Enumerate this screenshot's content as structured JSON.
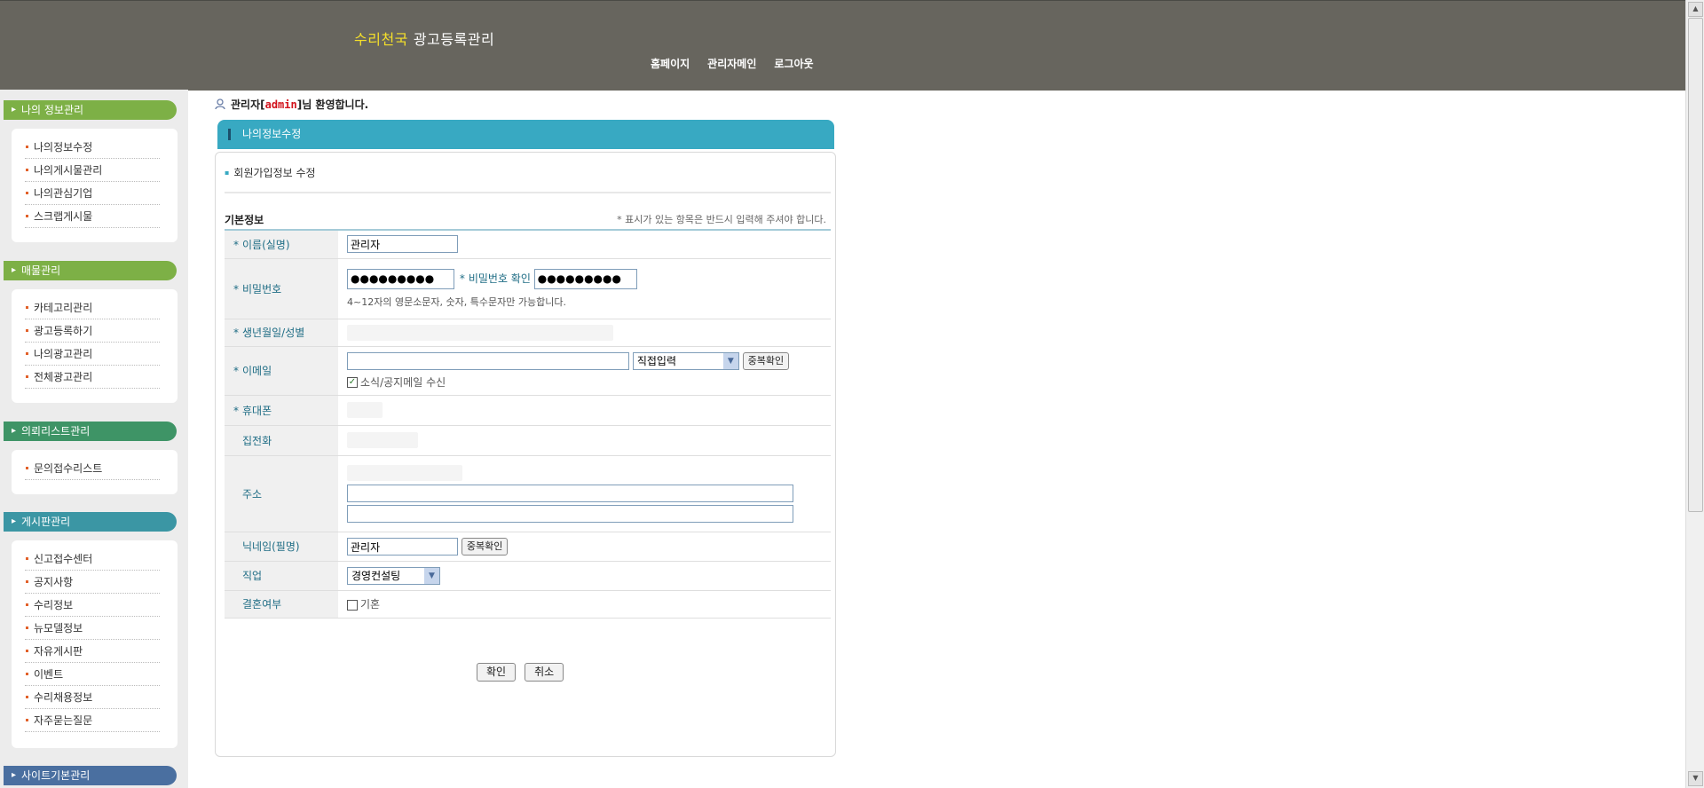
{
  "header": {
    "brand_highlight": "수리천국",
    "brand_rest": "광고등록관리",
    "nav": [
      "홈페이지",
      "관리자메인",
      "로그아웃"
    ]
  },
  "sidebar": {
    "sections": [
      {
        "title": "나의 정보관리",
        "color": "#7db046",
        "items": [
          "나의정보수정",
          "나의게시물관리",
          "나의관심기업",
          "스크랩게시물"
        ]
      },
      {
        "title": "매물관리",
        "color": "#7db046",
        "items": [
          "카테고리관리",
          "광고등록하기",
          "나의광고관리",
          "전체광고관리"
        ]
      },
      {
        "title": "의뢰리스트관리",
        "color": "#3e9466",
        "items": [
          "문의접수리스트"
        ]
      },
      {
        "title": "게시판관리",
        "color": "#3b96a4",
        "items": [
          "신고접수센터",
          "공지사항",
          "수리정보",
          "뉴모델정보",
          "자유게시판",
          "이벤트",
          "수리채용정보",
          "자주묻는질문"
        ]
      },
      {
        "title": "사이트기본관리",
        "color": "#4a6fa0",
        "items": []
      }
    ]
  },
  "welcome": {
    "prefix": "관리자[",
    "user": "admin",
    "suffix": "]님 환영합니다."
  },
  "tab": {
    "title": "나의정보수정"
  },
  "subtitle": "회원가입정보 수정",
  "form": {
    "title": "기본정보",
    "note": "* 표시가 있는 항목은 반드시 입력해 주셔야 합니다.",
    "name_label": "이름(실명)",
    "name_value": "관리자",
    "password_label": "비밀번호",
    "password_value": "●●●●●●●●●",
    "password_confirm_label": "비밀번호 확인",
    "password_confirm_value": "●●●●●●●●●",
    "password_hint": "4~12자의 영문소문자, 숫자, 특수문자만 가능합니다.",
    "birth_label": "생년월일/성별",
    "email_label": "이메일",
    "email_domain_select": "직접입력",
    "email_dup_button": "중복확인",
    "newsletter_label": "소식/공지메일 수신",
    "mobile_label": "휴대폰",
    "home_phone_label": "집전화",
    "address_label": "주소",
    "nickname_label": "닉네임(필명)",
    "nickname_value": "관리자",
    "nickname_dup_button": "중복확인",
    "job_label": "직업",
    "job_value": "경영컨설팅",
    "married_label": "결혼여부",
    "married_option": "기혼"
  },
  "actions": {
    "confirm": "확인",
    "cancel": "취소"
  }
}
